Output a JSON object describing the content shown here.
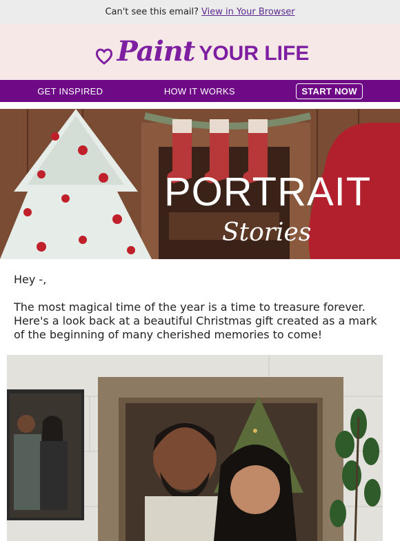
{
  "preheader": {
    "text": "Can't see this email?",
    "link": "View in Your Browser"
  },
  "brand": {
    "script": "Paint",
    "caps": "YOUR LIFE",
    "accent_color": "#7d1fa0"
  },
  "nav": {
    "items": [
      "GET INSPIRED",
      "HOW IT WORKS"
    ],
    "cta": "START NOW",
    "background": "#6e0a86"
  },
  "hero": {
    "title": "PORTRAIT",
    "subtitle": "Stories"
  },
  "body": {
    "greeting": "Hey -,",
    "paragraph": "The most magical time of the year is a time to treasure forever. Here's a look back at a beautiful Christmas gift created as a mark of the beginning of many cherished memories to come!"
  }
}
